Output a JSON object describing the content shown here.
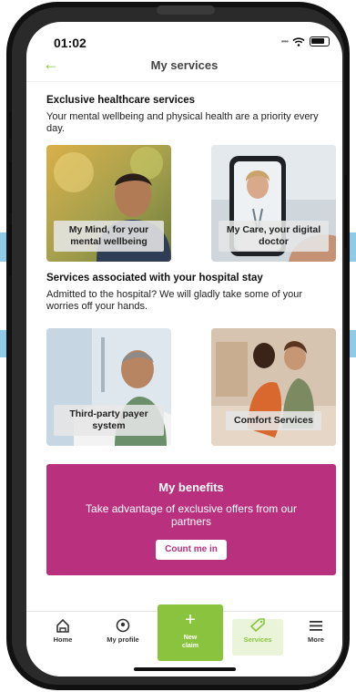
{
  "status": {
    "time": "01:02"
  },
  "header": {
    "back_icon": "arrow-left-icon",
    "title": "My services"
  },
  "healthcare": {
    "title": "Exclusive healthcare services",
    "description": "Your mental wellbeing and physical health are a priority every day.",
    "cards": [
      {
        "label": "My Mind, for your mental wellbeing"
      },
      {
        "label": "My Care, your digital doctor"
      }
    ]
  },
  "hospital": {
    "title": "Services associated with your hospital stay",
    "description": "Admitted to the hospital? We will gladly take some of your worries off your hands.",
    "cards": [
      {
        "label": "Third-party payer system"
      },
      {
        "label": "Comfort Services"
      }
    ]
  },
  "benefits": {
    "title": "My benefits",
    "text": "Take advantage of exclusive offers from our partners",
    "button": "Count me in"
  },
  "nav": {
    "items": [
      {
        "label": "Home",
        "icon": "home-icon"
      },
      {
        "label": "My profile",
        "icon": "profile-icon"
      },
      {
        "label": "New claim",
        "icon": "plus-icon"
      },
      {
        "label": "Services",
        "icon": "tag-icon"
      },
      {
        "label": "More",
        "icon": "menu-icon"
      }
    ]
  },
  "colors": {
    "accent_green": "#8ac43f",
    "benefits_magenta": "#b8307e",
    "side_blue": "#8fcbe6"
  }
}
